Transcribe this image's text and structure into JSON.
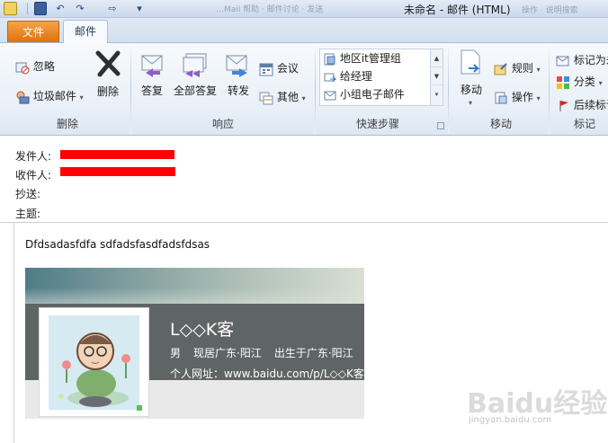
{
  "window": {
    "title": "未命名 - 邮件 (HTML)",
    "ghost_text_left": "…Mail 帮助 · 邮件讨论 · 发送",
    "ghost_text_right": "操作 · 说明搜索"
  },
  "tabs": [
    {
      "label": "文件"
    },
    {
      "label": "邮件"
    }
  ],
  "ribbon": {
    "groups": {
      "delete": {
        "label": "删除",
        "ignore": "忽略",
        "junk": "垃圾邮件",
        "delete_btn": "删除"
      },
      "respond": {
        "label": "响应",
        "reply": "答复",
        "reply_all": "全部答复",
        "forward": "转发",
        "meeting": "会议",
        "more": "其他"
      },
      "quick_steps": {
        "label": "快速步骤",
        "items": [
          {
            "label": "地区it管理组"
          },
          {
            "label": "给经理"
          },
          {
            "label": "小组电子邮件"
          }
        ]
      },
      "move": {
        "label": "移动",
        "move_btn": "移动",
        "rules": "规则",
        "actions": "操作"
      },
      "tags": {
        "label": "标记",
        "mark_as": "标记为未",
        "categorize": "分类",
        "follow_up": "后续标记"
      }
    }
  },
  "header": {
    "from_label": "发件人:",
    "to_label": "收件人:",
    "cc_label": "抄送:",
    "subject_label": "主题:"
  },
  "message": {
    "body_text": "Dfdsadasfdfa sdfadsfasdfadsfdsas",
    "card": {
      "name": "L◇◇K客",
      "gender": "男",
      "location": "现居广东·阳江",
      "birthplace": "出生于广东·阳江",
      "url": "个人网址：www.baidu.com/p/L◇◇K客"
    }
  },
  "watermark": {
    "logo": "Baidu经验",
    "sub": "jingyan.baidu.com"
  },
  "colors": {
    "file_tab": "#e0700d",
    "redaction": "#ff0000",
    "card_dark": "#5f6564"
  }
}
